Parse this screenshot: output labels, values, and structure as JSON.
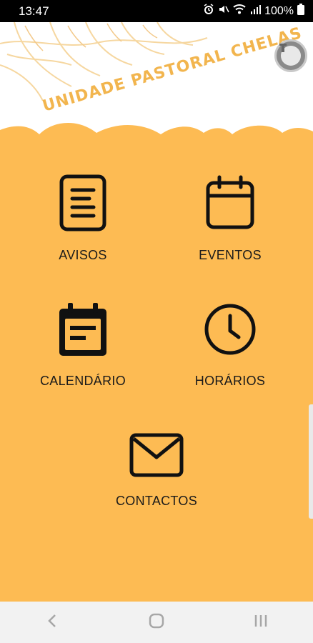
{
  "status_bar": {
    "time": "13:47",
    "battery": "100%",
    "icons": [
      "alarm-icon",
      "mute-icon",
      "wifi-icon",
      "signal-icon",
      "battery-icon"
    ]
  },
  "header": {
    "title": "UNIDADE PASTORAL CHELAS",
    "logo": "parish-logo-badge"
  },
  "menu": {
    "avisos": {
      "label": "AVISOS",
      "icon": "document-icon"
    },
    "eventos": {
      "label": "EVENTOS",
      "icon": "calendar-icon"
    },
    "calendario": {
      "label": "CALENDÁRIO",
      "icon": "calendar-notes-icon"
    },
    "horarios": {
      "label": "HORÁRIOS",
      "icon": "clock-icon"
    },
    "contactos": {
      "label": "CONTACTOS",
      "icon": "mail-icon"
    }
  },
  "colors": {
    "accent": "#FDBB53",
    "title": "#F2B54E",
    "icon": "#111111",
    "nav_bar": "#F2F2F2"
  },
  "nav_bar": {
    "icons": [
      "back-icon",
      "home-icon",
      "recents-icon"
    ]
  }
}
